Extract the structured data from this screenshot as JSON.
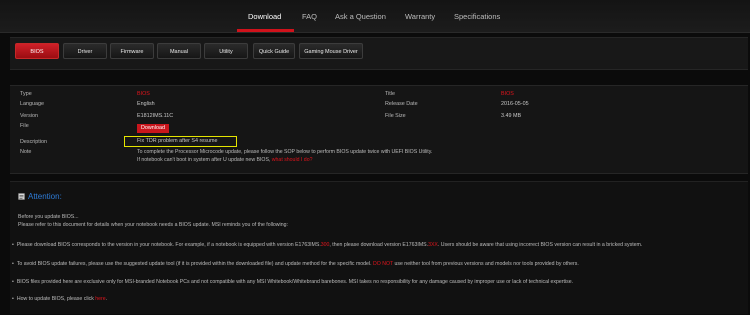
{
  "nav": {
    "items": [
      "Download",
      "FAQ",
      "Ask a Question",
      "Warranty",
      "Specifications"
    ],
    "active": "Download"
  },
  "tabs": [
    "BIOS",
    "Driver",
    "Firmware",
    "Manual",
    "Utility",
    "Quick Guide",
    "Gaming Mouse Driver"
  ],
  "active_tab": "BIOS",
  "details": {
    "type_label": "Type",
    "type_value": "BIOS",
    "language_label": "Language",
    "language_value": "English",
    "version_label": "Version",
    "version_value": "E1812IMS.11C",
    "file_label": "File",
    "file_button": "Download",
    "description_label": "Description",
    "description_value": "Fix TDR problem after S4 resume",
    "note_label": "Note",
    "note_line1": "To complete the Processor Microcode update, please follow the SOP below to perform BIOS update twice with UEFI BIOS Utility.",
    "note_line2_prefix": "If notebook can't boot in system after U update new BIOS, ",
    "note_line2_link": "what should I do?",
    "title_label": "Title",
    "title_value": "BIOS",
    "release_label": "Release Date",
    "release_value": "2016-05-05",
    "size_label": "File Size",
    "size_value": "3.49 MB"
  },
  "attention": {
    "title": "Attention:",
    "intro1": "Before you update BIOS...",
    "intro2": "Please refer to this document for details when your notebook needs a BIOS update. MSI reminds you of the following:",
    "b1_a": "Please download BIOS corresponds to the version in your notebook. For example, if a notebook is equipped with version E1763IMS.",
    "b1_red1": "300",
    "b1_b": ", then please download version E1763IMS.",
    "b1_red2": "3XX",
    "b1_c": ". Users should be aware that using incorrect BIOS version can result in a bricked system.",
    "b2_a": "To avoid BIOS update failures, please use the suggested update tool (if it is provided within the downloaded file) and update method for the specific model. ",
    "b2_red": "DO NOT",
    "b2_b": " use neither tool from previous versions and models nor tools provided by others.",
    "b3": "BIOS files provided here are exclusive only for MSI-branded Notebook PCs and not compatible with any MSI Whitebook/Whitebrand barebones. MSI takes no responsibility for any damage caused by improper use or lack of technical expertise.",
    "b4_a": "How to update BIOS, please click ",
    "b4_red": "here",
    "b4_b": "."
  }
}
